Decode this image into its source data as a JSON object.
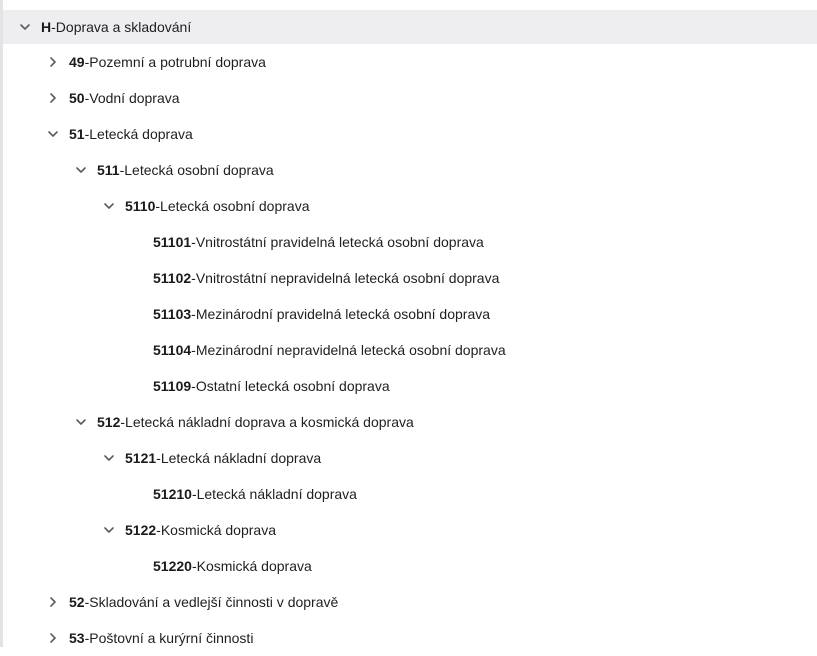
{
  "tree": {
    "nodes": [
      {
        "code": "H",
        "sep": " - ",
        "name": "Doprava a skladování",
        "expanded": true
      },
      {
        "code": "49",
        "sep": " - ",
        "name": "Pozemní a potrubní doprava",
        "expanded": false
      },
      {
        "code": "50",
        "sep": " - ",
        "name": "Vodní doprava",
        "expanded": false
      },
      {
        "code": "51",
        "sep": " - ",
        "name": "Letecká doprava",
        "expanded": true
      },
      {
        "code": "511",
        "sep": " - ",
        "name": "Letecká osobní doprava",
        "expanded": true
      },
      {
        "code": "5110",
        "sep": " - ",
        "name": "Letecká osobní doprava",
        "expanded": true
      },
      {
        "code": "51101",
        "sep": " - ",
        "name": "Vnitrostátní pravidelná letecká osobní doprava"
      },
      {
        "code": "51102",
        "sep": " - ",
        "name": "Vnitrostátní nepravidelná letecká osobní doprava"
      },
      {
        "code": "51103",
        "sep": " - ",
        "name": "Mezinárodní pravidelná letecká osobní doprava"
      },
      {
        "code": "51104",
        "sep": " - ",
        "name": "Mezinárodní nepravidelná letecká osobní doprava"
      },
      {
        "code": "51109",
        "sep": " - ",
        "name": "Ostatní letecká osobní doprava"
      },
      {
        "code": "512",
        "sep": " - ",
        "name": "Letecká nákladní doprava a kosmická doprava",
        "expanded": true
      },
      {
        "code": "5121",
        "sep": " - ",
        "name": "Letecká nákladní doprava",
        "expanded": true
      },
      {
        "code": "51210",
        "sep": " - ",
        "name": "Letecká nákladní doprava"
      },
      {
        "code": "5122",
        "sep": " - ",
        "name": "Kosmická doprava",
        "expanded": true
      },
      {
        "code": "51220",
        "sep": " - ",
        "name": "Kosmická doprava"
      },
      {
        "code": "52",
        "sep": " - ",
        "name": "Skladování a vedlejší činnosti v dopravě",
        "expanded": false
      },
      {
        "code": "53",
        "sep": " - ",
        "name": "Poštovní a kurýrní činnosti",
        "expanded": false
      }
    ]
  },
  "colors": {
    "selected_row_bg": "#eeeef1",
    "text": "#1f1f1f",
    "chevron": "#5b5b66"
  },
  "icons": {
    "expanded": "chevron-down-icon",
    "collapsed": "chevron-right-icon"
  }
}
